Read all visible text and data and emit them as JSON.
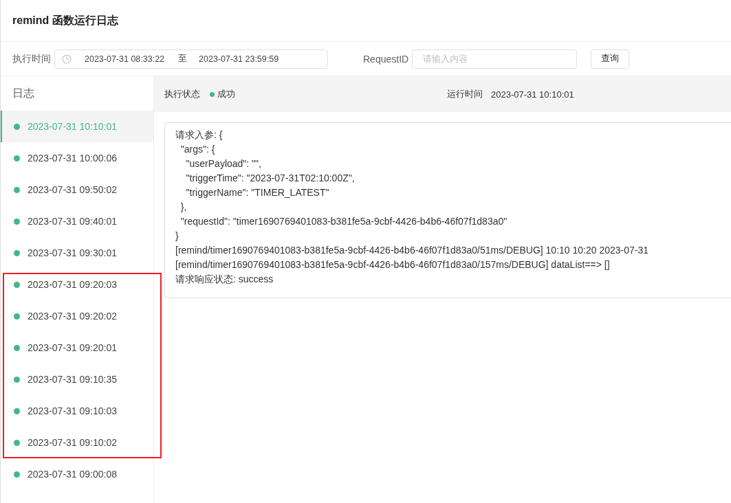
{
  "title": "remind 函数运行日志",
  "filters": {
    "time_label": "执行时间",
    "start": "2023-07-31 08:33:22",
    "separator": "至",
    "end": "2023-07-31 23:59:59",
    "request_label": "RequestID",
    "request_placeholder": "请输入内容",
    "query_button": "查询"
  },
  "sidebar": {
    "title": "日志",
    "items": [
      {
        "label": "2023-07-31 10:10:01",
        "selected": true
      },
      {
        "label": "2023-07-31 10:00:06",
        "selected": false
      },
      {
        "label": "2023-07-31 09:50:02",
        "selected": false
      },
      {
        "label": "2023-07-31 09:40:01",
        "selected": false
      },
      {
        "label": "2023-07-31 09:30:01",
        "selected": false
      },
      {
        "label": "2023-07-31 09:20:03",
        "selected": false
      },
      {
        "label": "2023-07-31 09:20:02",
        "selected": false
      },
      {
        "label": "2023-07-31 09:20:01",
        "selected": false
      },
      {
        "label": "2023-07-31 09:10:35",
        "selected": false
      },
      {
        "label": "2023-07-31 09:10:03",
        "selected": false
      },
      {
        "label": "2023-07-31 09:10:02",
        "selected": false
      },
      {
        "label": "2023-07-31 09:00:08",
        "selected": false
      }
    ]
  },
  "annotation": {
    "kind": "rectangle"
  },
  "detail": {
    "status_label": "执行状态",
    "status": "成功",
    "time_label": "运行时间",
    "time": "2023-07-31 10:10:01",
    "log_lines": [
      "请求入参: {",
      "  \"args\": {",
      "    \"userPayload\": \"\",",
      "    \"triggerTime\": \"2023-07-31T02:10:00Z\",",
      "    \"triggerName\": \"TIMER_LATEST\"",
      "  },",
      "  \"requestId\": \"timer1690769401083-b381fe5a-9cbf-4426-b4b6-46f07f1d83a0\"",
      "}",
      "[remind/timer1690769401083-b381fe5a-9cbf-4426-b4b6-46f07f1d83a0/51ms/DEBUG] 10:10 10:20 2023-07-31",
      "[remind/timer1690769401083-b381fe5a-9cbf-4426-b4b6-46f07f1d83a0/157ms/DEBUG] dataList==> []",
      "请求响应状态: success"
    ]
  }
}
